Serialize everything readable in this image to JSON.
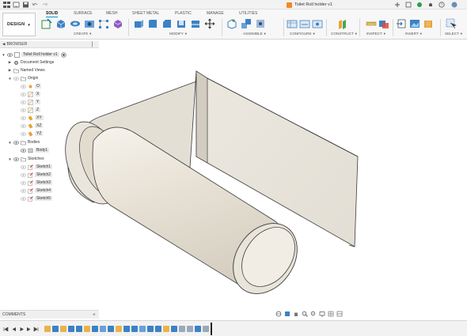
{
  "titlebar": {
    "document_title": "Toilet Roll holder v1"
  },
  "ribbon": {
    "workspace": "DESIGN",
    "tabs": [
      "SOLID",
      "SURFACE",
      "MESH",
      "SHEET METAL",
      "PLASTIC",
      "MANAGE",
      "UTILITIES"
    ],
    "active_tab": "SOLID",
    "groups": [
      "CREATE",
      "MODIFY",
      "ASSEMBLE",
      "CONFIGURE",
      "CONSTRUCT",
      "INSPECT",
      "INSERT",
      "SELECT"
    ],
    "accent": "#0696d7"
  },
  "browser": {
    "title": "BROWSER",
    "items": [
      {
        "label": "Toilet Roll holder v1",
        "icon": "document-icon"
      },
      {
        "label": "Document Settings",
        "icon": "gear-icon"
      },
      {
        "label": "Named Views",
        "icon": "folder-icon"
      },
      {
        "label": "Origin",
        "icon": "folder-icon"
      },
      {
        "label": "O",
        "icon": "origin-point-icon"
      },
      {
        "label": "X",
        "icon": "axis-icon"
      },
      {
        "label": "Y",
        "icon": "axis-icon"
      },
      {
        "label": "Z",
        "icon": "axis-icon"
      },
      {
        "label": "XY",
        "icon": "plane-icon"
      },
      {
        "label": "XZ",
        "icon": "plane-icon"
      },
      {
        "label": "YZ",
        "icon": "plane-icon"
      },
      {
        "label": "Bodies",
        "icon": "folder-icon"
      },
      {
        "label": "Body1",
        "icon": "body-icon"
      },
      {
        "label": "Sketches",
        "icon": "folder-icon"
      },
      {
        "label": "Sketch1",
        "icon": "sketch-icon"
      },
      {
        "label": "Sketch2",
        "icon": "sketch-icon"
      },
      {
        "label": "Sketch3",
        "icon": "sketch-icon"
      },
      {
        "label": "Sketch4",
        "icon": "sketch-icon"
      },
      {
        "label": "Sketch5",
        "icon": "sketch-icon"
      }
    ]
  },
  "comments": {
    "title": "COMMENTS"
  }
}
